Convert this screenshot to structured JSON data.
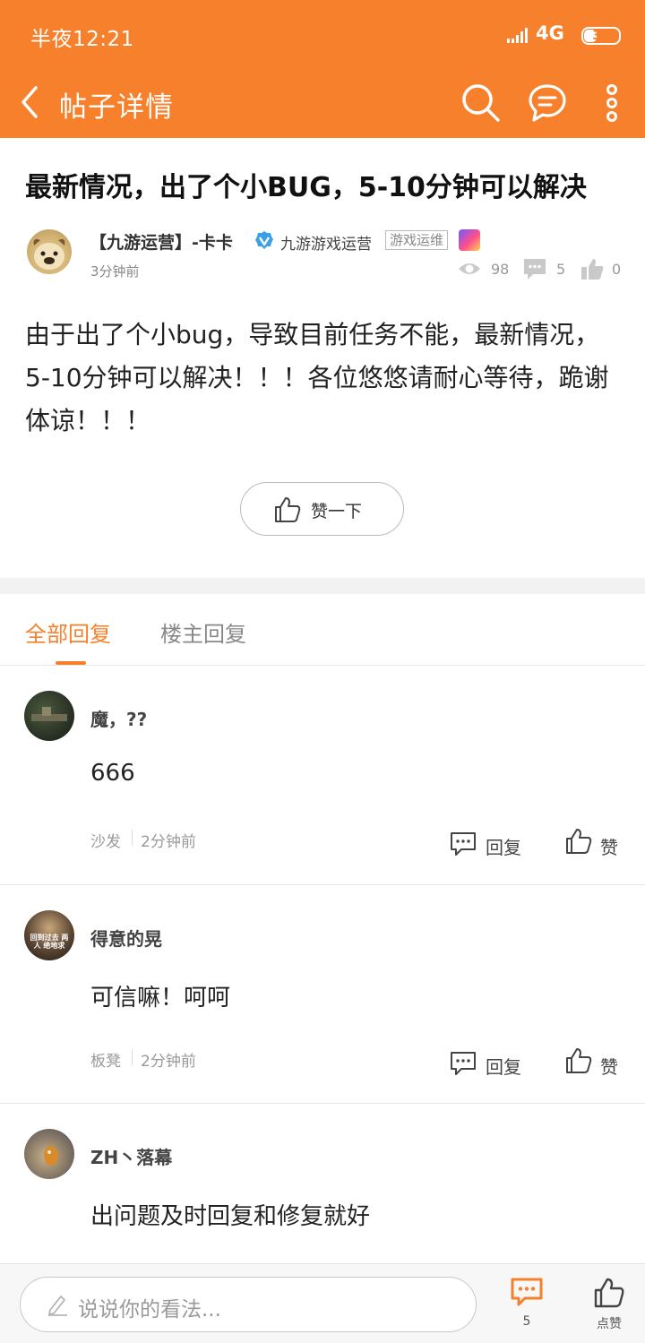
{
  "status_bar": {
    "time": "半夜12:21",
    "network": "4G",
    "battery": "37"
  },
  "nav": {
    "title": "帖子详情"
  },
  "post": {
    "title": "最新情况，出了个小BUG，5-10分钟可以解决",
    "author": {
      "name": "【九游运营】-卡卡",
      "org": "九游游戏运营",
      "tag": "游戏运维",
      "time": "3分钟前"
    },
    "stats": {
      "views": "98",
      "comments": "5",
      "likes": "0"
    },
    "body": "由于出了个小bug，导致目前任务不能，最新情况，5-10分钟可以解决！！！各位悠悠请耐心等待，跪谢体谅！！！",
    "like_button": "赞一下"
  },
  "tabs": [
    {
      "label": "全部回复",
      "active": true
    },
    {
      "label": "楼主回复",
      "active": false
    }
  ],
  "comments": [
    {
      "name": "魔，??",
      "text": "666",
      "floor": "沙发",
      "time": "2分钟前",
      "reply_label": "回复",
      "like_label": "赞"
    },
    {
      "name": "得意的晃",
      "text": "可信嘛！呵呵",
      "floor": "板凳",
      "time": "2分钟前",
      "reply_label": "回复",
      "like_label": "赞",
      "avatar_text": "回到过去 两人 绝地求"
    },
    {
      "name": "ZH丶落幕",
      "text": "出问题及时回复和修复就好"
    }
  ],
  "bottom_bar": {
    "input_placeholder": "说说你的看法...",
    "comment_count": "5",
    "like_label": "点赞"
  },
  "colors": {
    "accent": "#f6802c",
    "verified": "#3aa0e8"
  }
}
